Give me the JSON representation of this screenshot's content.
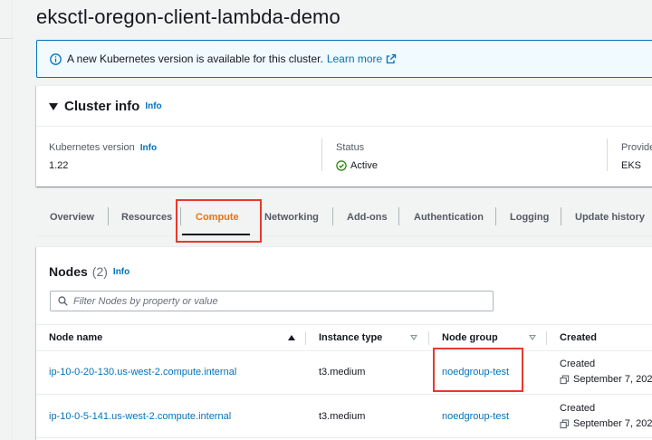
{
  "page": {
    "title": "eksctl-oregon-client-lambda-demo"
  },
  "banner": {
    "message": "A new Kubernetes version is available for this cluster.",
    "link": "Learn more"
  },
  "cluster_info": {
    "heading": "Cluster info",
    "info": "Info",
    "kubernetes_version": {
      "label": "Kubernetes version",
      "info": "Info",
      "value": "1.22"
    },
    "status": {
      "label": "Status",
      "value": "Active"
    },
    "provider": {
      "label": "Provide",
      "value": "EKS"
    }
  },
  "tabs": [
    "Overview",
    "Resources",
    "Compute",
    "Networking",
    "Add-ons",
    "Authentication",
    "Logging",
    "Update history"
  ],
  "selected_tab": "Compute",
  "nodes": {
    "title": "Nodes",
    "count": "(2)",
    "info": "Info",
    "filter_placeholder": "Filter Nodes by property or value",
    "columns": [
      "Node name",
      "Instance type",
      "Node group",
      "Created"
    ],
    "rows": [
      {
        "name": "ip-10-0-20-130.us-west-2.compute.internal",
        "instance_type": "t3.medium",
        "node_group": "noedgroup-test",
        "created_label": "Created",
        "created": "September 7, 202"
      },
      {
        "name": "ip-10-0-5-141.us-west-2.compute.internal",
        "instance_type": "t3.medium",
        "node_group": "noedgroup-test",
        "created_label": "Created",
        "created": "September 7, 202"
      }
    ]
  },
  "colors": {
    "link": "#0073bb",
    "selected_tab": "#ec7211",
    "active": "#1d8102",
    "highlight": "#e8392b"
  }
}
